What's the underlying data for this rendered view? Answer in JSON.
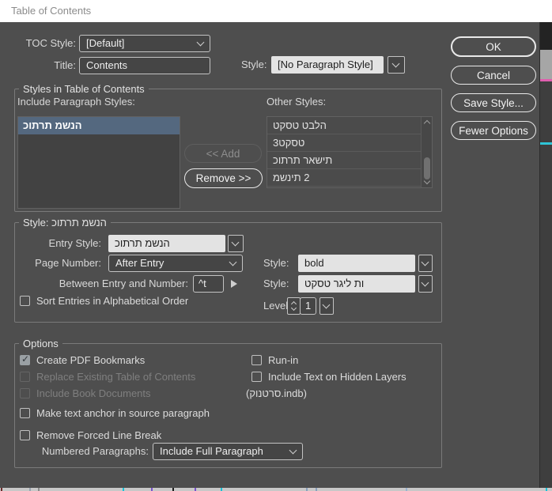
{
  "window": {
    "title": "Table of Contents"
  },
  "header": {
    "toc_style_label": "TOC Style:",
    "toc_style_value": "[Default]",
    "title_label": "Title:",
    "title_value": "Contents",
    "style_label": "Style:",
    "style_value": "[No Paragraph Style]"
  },
  "action_buttons": {
    "ok": "OK",
    "cancel": "Cancel",
    "save_style": "Save Style...",
    "fewer_options": "Fewer Options"
  },
  "styles_group": {
    "legend": "Styles in Table of Contents",
    "include_label": "Include Paragraph Styles:",
    "include_items": [
      {
        "label": "כותרת משנה",
        "selected": true
      }
    ],
    "add_button": "<< Add",
    "remove_button": "Remove >>",
    "other_label": "Other Styles:",
    "other_items": [
      "טקסט טבלה",
      "3טקסט",
      "כותרת ראשית",
      "משנית 2"
    ]
  },
  "style_group": {
    "legend": "Style: כותרת משנה",
    "entry_style_label": "Entry Style:",
    "entry_style_value": "כותרת משנה",
    "page_number_label": "Page Number:",
    "page_number_value": "After Entry",
    "between_label": "Between Entry and Number:",
    "between_value": "^t",
    "sort_label": "Sort Entries in Alphabetical Order",
    "page_style_label": "Style:",
    "page_style_value": "bold",
    "between_style_label": "Style:",
    "between_style_value": "טקסט רגיל תו",
    "level_label": "Level:",
    "level_value": "1"
  },
  "options_group": {
    "legend": "Options",
    "checkboxes_left": [
      {
        "label": "Create PDF Bookmarks",
        "checked": true,
        "enabled": true
      },
      {
        "label": "Replace Existing Table of Contents",
        "checked": false,
        "enabled": false
      },
      {
        "label": "Include Book Documents",
        "checked": false,
        "enabled": false
      },
      {
        "label": "Make text anchor in source paragraph",
        "checked": false,
        "enabled": true
      },
      {
        "label": "Remove Forced Line Break",
        "checked": false,
        "enabled": true
      }
    ],
    "checkboxes_right": [
      {
        "label": "Run-in",
        "checked": false,
        "enabled": true
      },
      {
        "label": "Include Text on Hidden Layers",
        "checked": false,
        "enabled": true
      }
    ],
    "book_filename": "(קונטרס.indb)",
    "numbered_label": "Numbered Paragraphs:",
    "numbered_value": "Include Full Paragraph"
  },
  "colors": {
    "dialog_bg": "#4e4e4e",
    "titlebar_bg": "#ffffff",
    "selection": "#54687f",
    "field_light": "#e3e3e3",
    "accent_pink": "#df5fae",
    "accent_cyan": "#2ec4d6"
  }
}
